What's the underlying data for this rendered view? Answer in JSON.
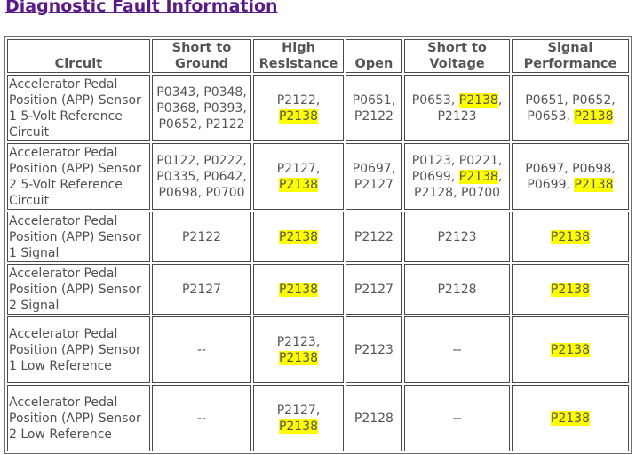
{
  "page": {
    "title": "Diagnostic Fault Information"
  },
  "colors": {
    "title": "#5a1a87",
    "highlight": "#ffff00",
    "text": "#555555"
  },
  "table": {
    "headers": {
      "circuit": "Circuit",
      "short_to_ground": "Short to Ground",
      "high_resistance": "High Resistance",
      "open": "Open",
      "short_to_voltage": "Short to Voltage",
      "signal_performance": "Signal Performance"
    },
    "highlight_code": "P2138",
    "rows": [
      {
        "circuit": "Accelerator Pedal Position (APP) Sensor 1 5-Volt Reference Circuit",
        "short_to_ground": "P0343, P0348, P0368, P0393, P0652, P2122",
        "high_resistance": "P2122, P2138",
        "open": "P0651, P2122",
        "short_to_voltage": "P0653, P2138, P2123",
        "signal_performance": "P0651, P0652, P0653, P2138"
      },
      {
        "circuit": "Accelerator Pedal Position (APP) Sensor 2 5-Volt Reference Circuit",
        "short_to_ground": "P0122, P0222, P0335, P0642, P0698, P0700",
        "high_resistance": "P2127, P2138",
        "open": "P0697, P2127",
        "short_to_voltage": "P0123, P0221, P0699, P2138, P2128, P0700",
        "signal_performance": "P0697, P0698, P0699, P2138"
      },
      {
        "circuit": "Accelerator Pedal Position (APP) Sensor 1 Signal",
        "short_to_ground": "P2122",
        "high_resistance": "P2138",
        "open": "P2122",
        "short_to_voltage": "P2123",
        "signal_performance": "P2138"
      },
      {
        "circuit": "Accelerator Pedal Position (APP) Sensor 2 Signal",
        "short_to_ground": "P2127",
        "high_resistance": "P2138",
        "open": "P2127",
        "short_to_voltage": "P2128",
        "signal_performance": "P2138"
      },
      {
        "circuit": "Accelerator Pedal Position (APP) Sensor 1 Low Reference",
        "short_to_ground": "--",
        "high_resistance": "P2123, P2138",
        "open": "P2123",
        "short_to_voltage": "--",
        "signal_performance": "P2138"
      },
      {
        "circuit": "Accelerator Pedal Position (APP) Sensor 2 Low Reference",
        "short_to_ground": "--",
        "high_resistance": "P2127, P2138",
        "open": "P2128",
        "short_to_voltage": "--",
        "signal_performance": "P2138"
      }
    ]
  }
}
